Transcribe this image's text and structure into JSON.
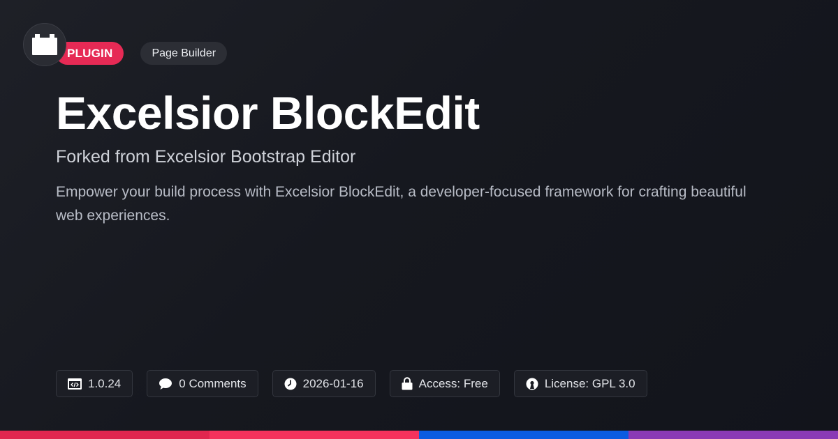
{
  "badges": {
    "type_label": "PLUGIN",
    "category_label": "Page Builder"
  },
  "title": "Excelsior BlockEdit",
  "subtitle": "Forked from Excelsior Bootstrap Editor",
  "description": "Empower your build process with Excelsior BlockEdit, a developer-focused framework for crafting beautiful web experiences.",
  "meta": [
    {
      "icon": "code-window-icon",
      "text": "1.0.24"
    },
    {
      "icon": "comment-icon",
      "text": "0 Comments"
    },
    {
      "icon": "clock-icon",
      "text": "2026-01-16"
    },
    {
      "icon": "lock-icon",
      "text": "Access: Free"
    },
    {
      "icon": "open-source-icon",
      "text": "License: GPL 3.0"
    }
  ],
  "colors": {
    "accent_pink": "#e62a55",
    "bar_segments": [
      "#e0264f",
      "#f5325c",
      "#0b5ce1",
      "#8a3ab5"
    ]
  }
}
